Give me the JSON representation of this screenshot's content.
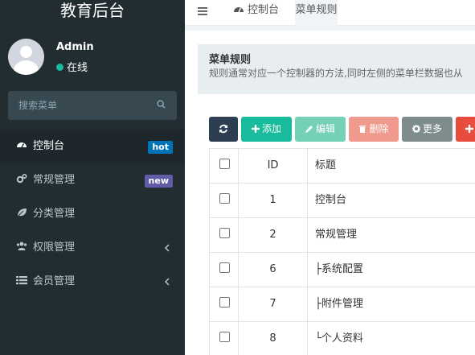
{
  "app": {
    "title": "教育后台"
  },
  "user": {
    "name": "Admin",
    "status": "在线"
  },
  "search": {
    "placeholder": "搜索菜单"
  },
  "menu": [
    {
      "label": "控制台",
      "badge": "hot"
    },
    {
      "label": "常规管理",
      "badge": "new"
    },
    {
      "label": "分类管理"
    },
    {
      "label": "权限管理"
    },
    {
      "label": "会员管理"
    }
  ],
  "tabs": [
    {
      "label": "控制台"
    },
    {
      "label": "菜单规则"
    }
  ],
  "panel": {
    "title": "菜单规则",
    "description": "规则通常对应一个控制器的方法,同时左侧的菜单栏数据也从"
  },
  "toolbar": {
    "add": "添加",
    "edit": "编辑",
    "delete": "删除",
    "more": "更多"
  },
  "table": {
    "headers": {
      "id": "ID",
      "title": "标题"
    },
    "rows": [
      {
        "id": "1",
        "title": "控制台"
      },
      {
        "id": "2",
        "title": "常规管理"
      },
      {
        "id": "6",
        "title": "├系统配置"
      },
      {
        "id": "7",
        "title": "├附件管理"
      },
      {
        "id": "8",
        "title": "└个人资料"
      }
    ]
  },
  "colors": {
    "sidebar_bg": "#222d32",
    "accent_green": "#18bc9c",
    "badge_hot": "#0073b7",
    "badge_new": "#605ca8",
    "danger": "#e74c3c"
  }
}
